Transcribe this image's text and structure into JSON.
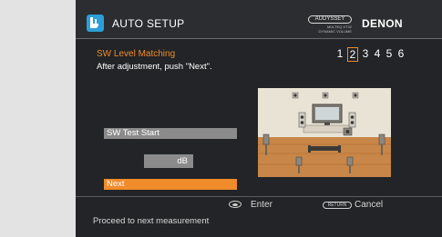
{
  "header": {
    "title": "AUTO SETUP",
    "audyssey_badge": "AUDYSSEY",
    "audyssey_line1": "MULTEQ XT32",
    "audyssey_line2": "DYNAMIC VOLUME",
    "brand": "DENON"
  },
  "step": {
    "title": "SW Level Matching",
    "instruction": "After adjustment, push \"Next\".",
    "numbers": [
      "1",
      "2",
      "3",
      "4",
      "5",
      "6"
    ],
    "active_index": 1
  },
  "controls": {
    "test_start_label": "SW Test Start",
    "level_unit": "dB",
    "next_label": "Next"
  },
  "footer": {
    "enter_label": "Enter",
    "return_key": "RETURN",
    "cancel_label": "Cancel",
    "status": "Proceed to next measurement"
  },
  "colors": {
    "accent": "#f08c2a",
    "background": "#222427",
    "button_gray": "#8b8b8b",
    "icon_blue": "#2c9fd8"
  }
}
